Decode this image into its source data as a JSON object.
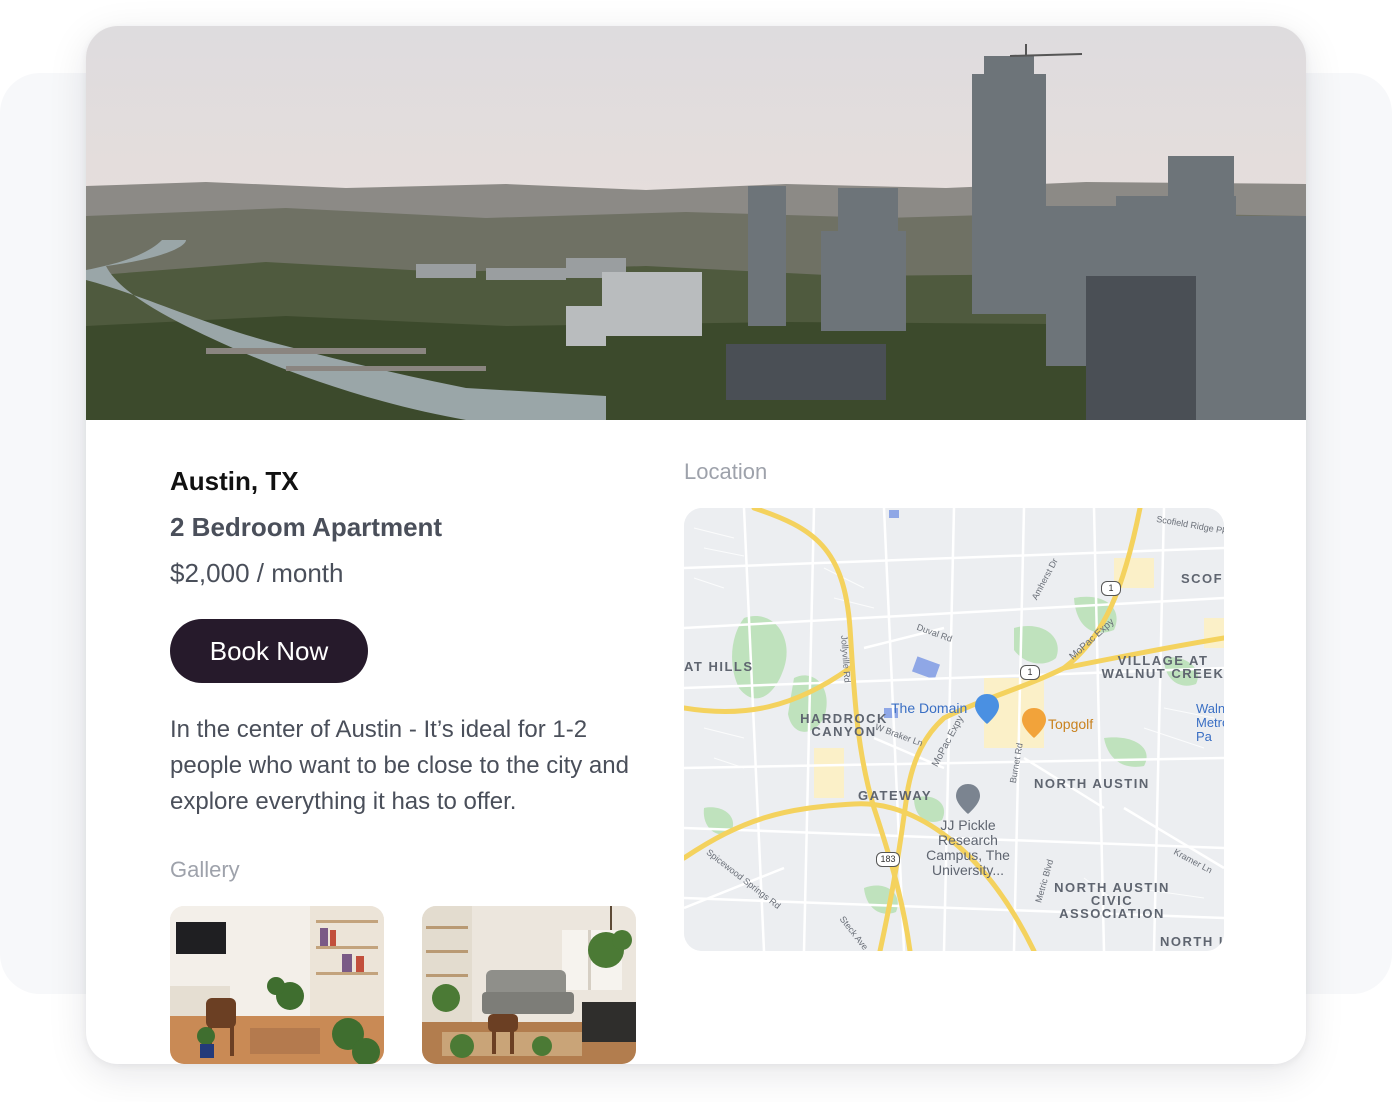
{
  "listing": {
    "city": "Austin, TX",
    "type": "2 Bedroom Apartment",
    "price": "$2,000 / month",
    "book_label": "Book Now",
    "description": "In the center of Austin - It’s ideal for 1-2 people who want to be close to the city and explore everything it has to offer."
  },
  "gallery": {
    "label": "Gallery"
  },
  "location": {
    "label": "Location",
    "map": {
      "areas": {
        "hardrock_canyon": "HARDROCK CANYON",
        "gateway": "GATEWAY",
        "north_austin": "NORTH AUSTIN",
        "village_walnut_creek": "VILLAGE AT WALNUT CREEK",
        "north_austin_civic": "NORTH AUSTIN CIVIC ASSOCIATION",
        "scofi": "SCOFI",
        "north_i": "NORTH I",
        "at_hills": "AT HILLS",
        "walnut_metro": "Walnu Metro Pa"
      },
      "pois": {
        "the_domain": "The Domain",
        "topgolf": "Topgolf",
        "jj_pickle": "JJ Pickle Research Campus, The University..."
      },
      "streets": {
        "mopac_expy_1": "MoPac Expy",
        "mopac_expy_2": "MoPac Expy",
        "duval_rd": "Duval Rd",
        "amherst_dr": "Amherst Dr",
        "jollyville_rd": "Jollyville Rd",
        "w_braker_ln": "W Braker Ln",
        "burnet_rd": "Burnet Rd",
        "metric_blvd": "Metric Blvd",
        "kramer_ln": "Kramer Ln",
        "spicewood_springs_rd": "Spicewood Springs Rd",
        "steck_ave": "Steck Ave",
        "scofield_ridge_pkwy": "Scofield Ridge Pk"
      },
      "shields": {
        "loop1_a": "1",
        "loop1_b": "1",
        "us183": "183"
      }
    }
  }
}
